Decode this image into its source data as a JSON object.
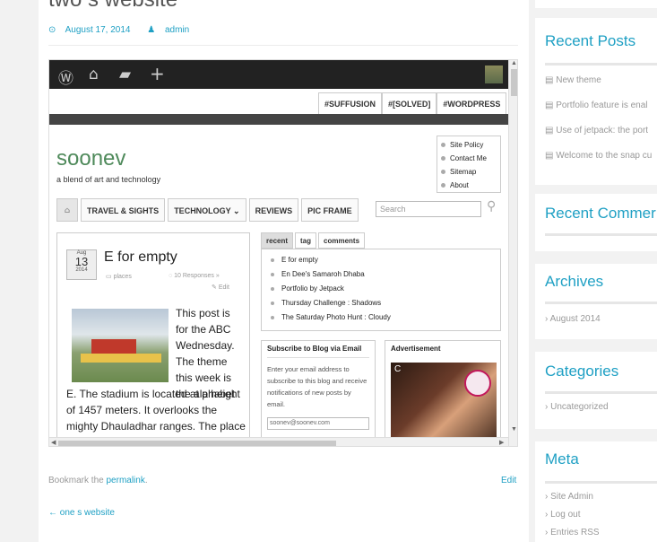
{
  "post": {
    "title": "two s website",
    "date": "August 17, 2014",
    "author": "admin",
    "bookmark_prefix": "Bookmark the ",
    "permalink": "permalink",
    "bookmark_suffix": ".",
    "edit": "Edit",
    "prev_link": "← one s website"
  },
  "screenshot": {
    "wp_icons": [
      "wordpress-icon",
      "home-icon",
      "comment-icon",
      "plus-icon"
    ],
    "tags": [
      "#SUFFUSION",
      "#[SOLVED]",
      "#WORDPRESS"
    ],
    "blog_name": "soonev",
    "tagline": "a blend of art and technology",
    "pages": [
      "Site Policy",
      "Contact Me",
      "Sitemap",
      "About"
    ],
    "nav": [
      "TRAVEL & SIGHTS",
      "TECHNOLOGY ⌄",
      "REVIEWS",
      "PIC FRAME"
    ],
    "search_placeholder": "Search",
    "post": {
      "month": "Aug",
      "day": "13",
      "year": "2014",
      "title": "E for empty",
      "category": "places",
      "responses": "10 Responses »",
      "edit": "Edit",
      "text_right": "This post is for the ABC Wednesday. The theme this week is the alphabet",
      "text_below": "E. The stadium is located at a height of 1457 meters. It overlooks the mighty Dhauladhar ranges. The place is"
    },
    "tabs": [
      "recent",
      "tag",
      "comments"
    ],
    "recent_posts": [
      "E for empty",
      "En Dee's Samaroh Dhaba",
      "Portfolio by Jetpack",
      "Thursday Challenge : Shadows",
      "The Saturday Photo Hunt : Cloudy"
    ],
    "subscribe": {
      "heading": "Subscribe to Blog via Email",
      "text": "Enter your email address to subscribe to this blog and receive notifications of new posts by email.",
      "email_value": "soonev@soonev.com"
    },
    "ad_heading": "Advertisement"
  },
  "sidebar": {
    "recent_posts_title": "Recent Posts",
    "recent_posts": [
      "New theme",
      "Portfolio feature is enal",
      "Use of jetpack: the port",
      "Welcome to the snap cu"
    ],
    "recent_comments_title": "Recent Commer",
    "archives_title": "Archives",
    "archives": [
      "August 2014"
    ],
    "categories_title": "Categories",
    "categories": [
      "Uncategorized"
    ],
    "meta_title": "Meta",
    "meta": [
      "Site Admin",
      "Log out",
      "Entries RSS"
    ]
  },
  "colors": {
    "accent": "#1fa0c4",
    "blog_name": "#4f8a5b",
    "wp_bar": "#222222"
  }
}
